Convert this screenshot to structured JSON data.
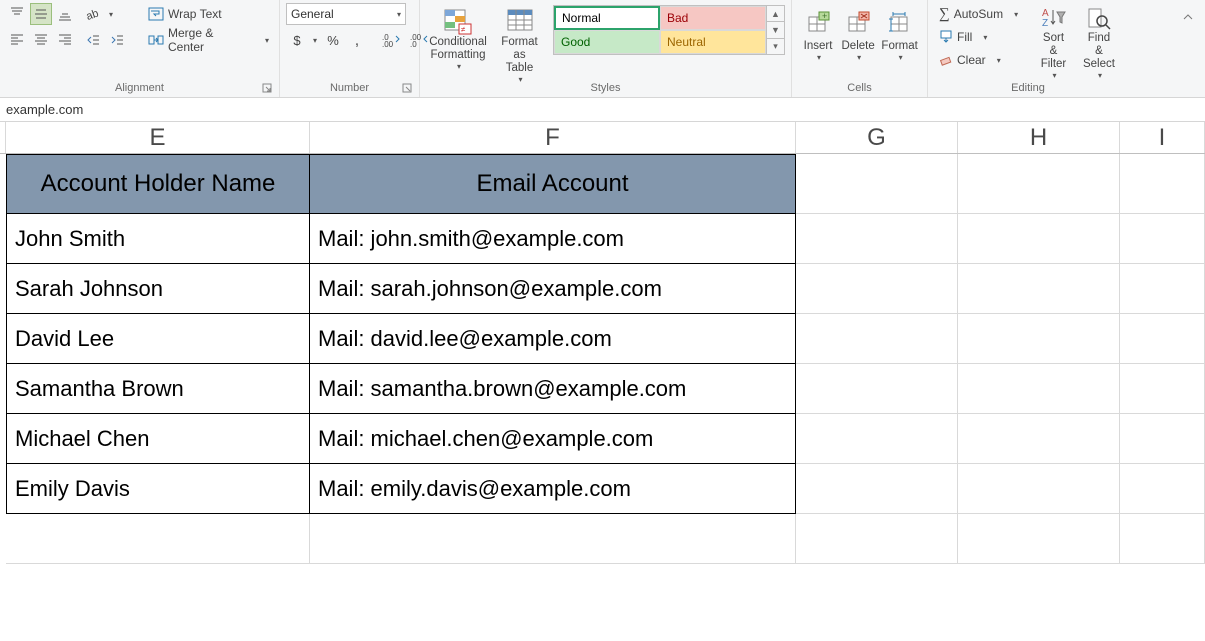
{
  "ribbon": {
    "alignment": {
      "wrap_text": "Wrap Text",
      "merge_center": "Merge & Center",
      "group": "Alignment"
    },
    "number": {
      "format": "General",
      "group": "Number"
    },
    "styles": {
      "cond_fmt": "Conditional\nFormatting",
      "fmt_table": "Format as\nTable",
      "normal": "Normal",
      "bad": "Bad",
      "good": "Good",
      "neutral": "Neutral",
      "group": "Styles"
    },
    "cells": {
      "insert": "Insert",
      "delete": "Delete",
      "format": "Format",
      "group": "Cells"
    },
    "editing": {
      "autosum": "AutoSum",
      "fill": "Fill",
      "clear": "Clear",
      "sort": "Sort &\nFilter",
      "find": "Find &\nSelect",
      "group": "Editing"
    }
  },
  "formula_bar": "example.com",
  "columns": {
    "E": "E",
    "F": "F",
    "G": "G",
    "H": "H",
    "I": "I"
  },
  "table": {
    "headers": {
      "name": "Account Holder Name",
      "email": "Email Account"
    },
    "rows": [
      {
        "name": "John Smith",
        "email": "Mail: john.smith@example.com"
      },
      {
        "name": "Sarah Johnson",
        "email": "Mail: sarah.johnson@example.com"
      },
      {
        "name": "David Lee",
        "email": "Mail: david.lee@example.com"
      },
      {
        "name": "Samantha Brown",
        "email": "Mail: samantha.brown@example.com"
      },
      {
        "name": "Michael Chen",
        "email": "Mail: michael.chen@example.com"
      },
      {
        "name": "Emily Davis",
        "email": "Mail: emily.davis@example.com"
      }
    ]
  }
}
